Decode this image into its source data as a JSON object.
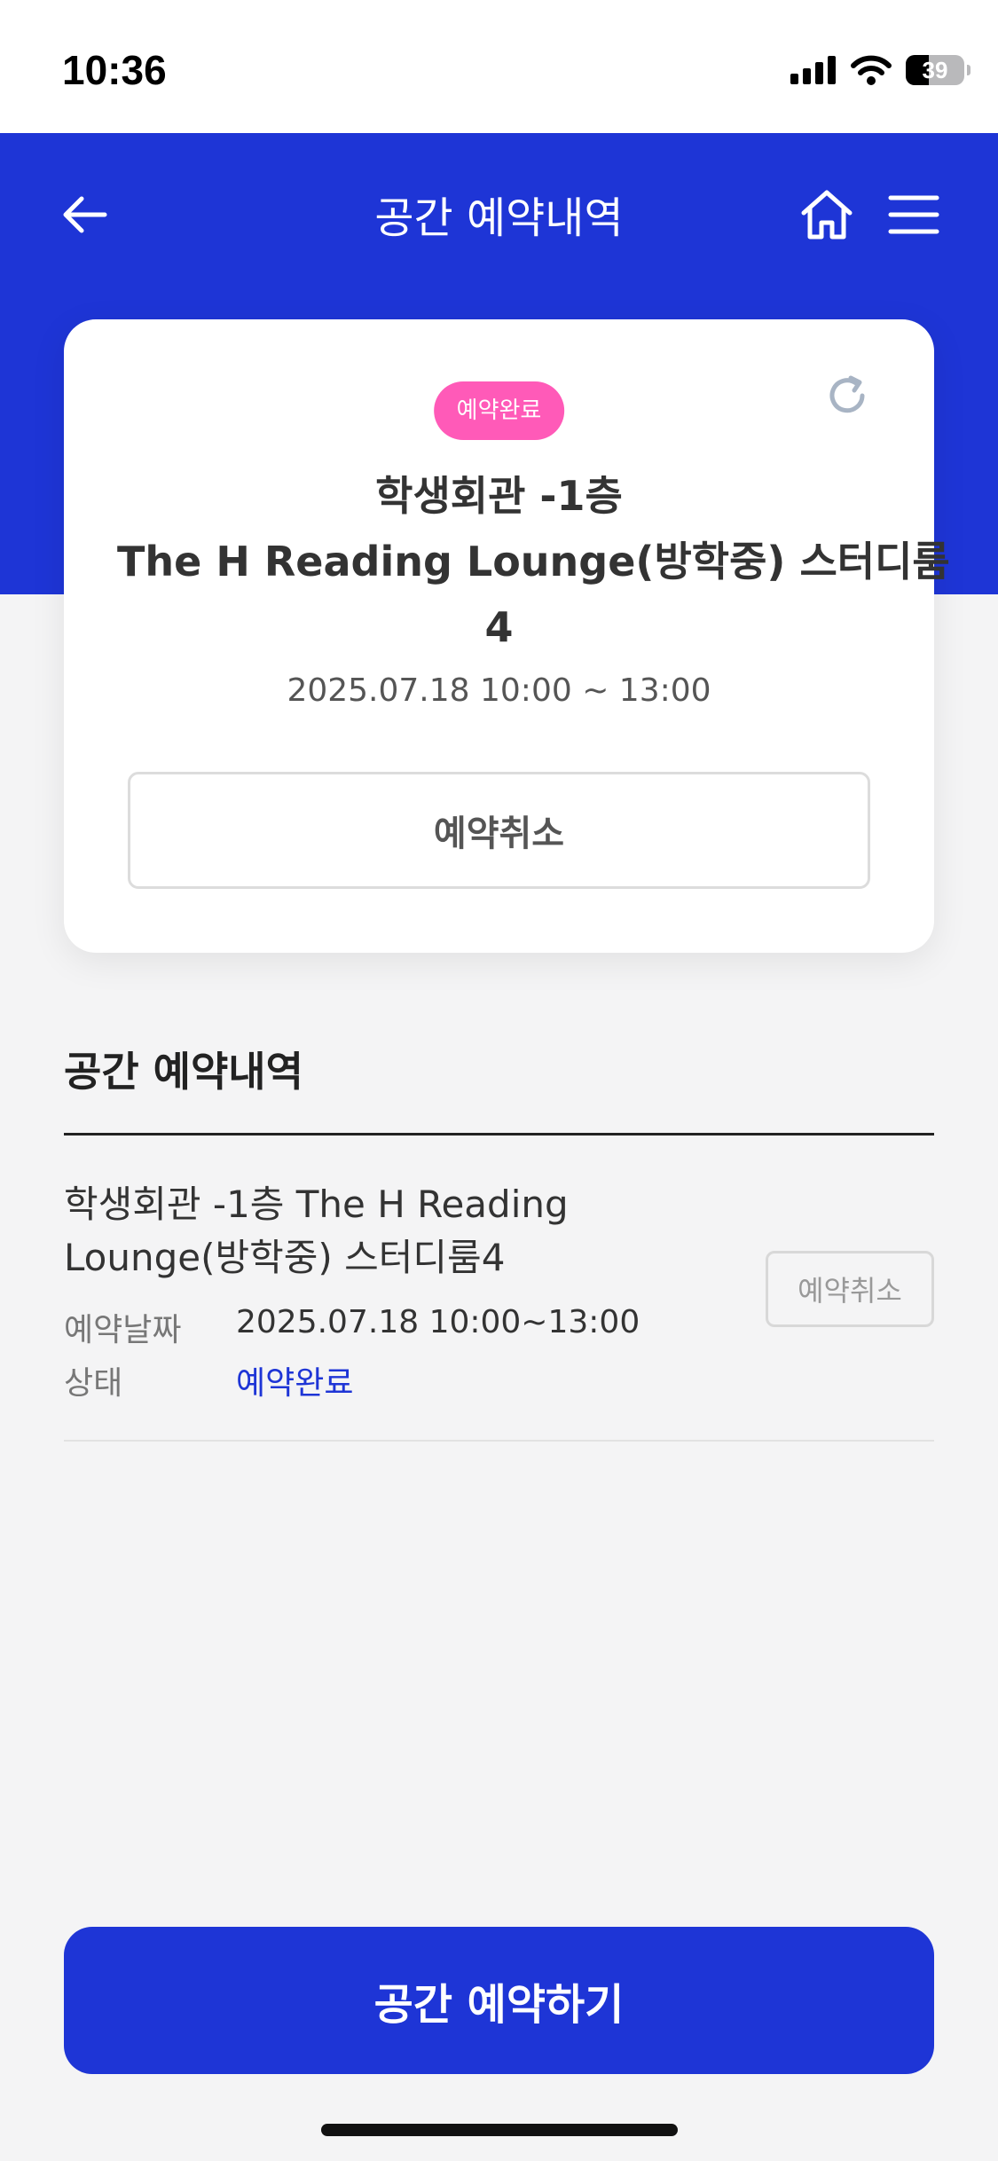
{
  "status_bar": {
    "time": "10:36",
    "battery": "39"
  },
  "header": {
    "title": "공간 예약내역"
  },
  "card": {
    "badge": "예약완료",
    "title_line1": "학생회관 -1층",
    "title_line2": "The H Reading Lounge(방학중) 스터디룸",
    "title_line3": "4",
    "datetime": "2025.07.18 10:00 ~ 13:00",
    "cancel_label": "예약취소"
  },
  "section": {
    "title": "공간 예약내역"
  },
  "reservations": [
    {
      "name_line1": "학생회관 -1층 The H Reading",
      "name_line2": "Lounge(방학중) 스터디룸4",
      "date_label": "예약날짜",
      "date_value": "2025.07.18 10:00~13:00",
      "status_label": "상태",
      "status_value": "예약완료",
      "cancel_label": "예약취소"
    }
  ],
  "footer": {
    "button_label": "공간 예약하기"
  },
  "colors": {
    "primary": "#1e35d6",
    "badge": "#ff5ab8",
    "background": "#f4f4f5"
  }
}
